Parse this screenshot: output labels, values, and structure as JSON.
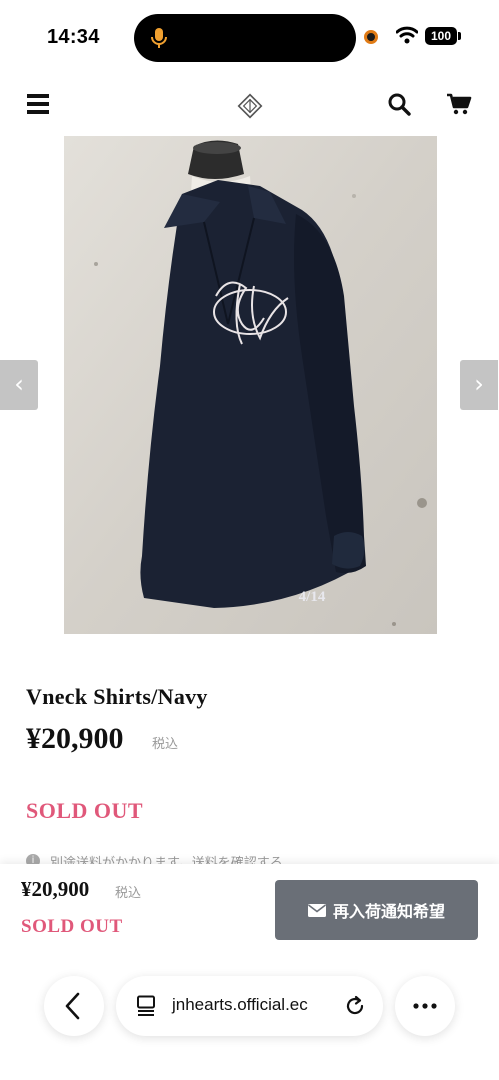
{
  "status_bar": {
    "time": "14:34",
    "battery": "100"
  },
  "header": {
    "icons": [
      "menu-icon",
      "logo-icon",
      "search-icon",
      "cart-icon"
    ]
  },
  "gallery": {
    "counter": "4/14",
    "prev_arrow": "‹",
    "next_arrow": "›"
  },
  "product": {
    "title": "Vneck Shirts/Navy",
    "price": "¥20,900",
    "tax_label": "税込",
    "status": "SOLD OUT",
    "shipping_note": "別途送料がかかります。送料を確認する"
  },
  "sticky": {
    "price": "¥20,900",
    "tax_label": "税込",
    "status": "SOLD OUT",
    "restock_label": "再入荷通知希望"
  },
  "browser": {
    "url": "jnhearts.official.ec"
  },
  "colors": {
    "sold_out": "#e0587a",
    "button_bg": "#6a6f77",
    "shirt": "#1b2233"
  }
}
